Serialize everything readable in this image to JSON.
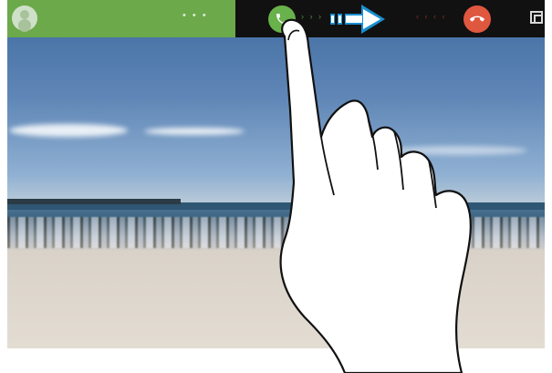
{
  "incoming_call": {
    "caller_name": "",
    "overlay_label": ""
  },
  "icons": {
    "caller_avatar": "person-avatar-icon",
    "answer": "phone-answer-icon",
    "reject": "phone-reject-icon",
    "swipe": "swipe-right-arrow-icon",
    "expand": "expand-window-icon",
    "gesture": "finger-swipe-hand-icon"
  },
  "colors": {
    "caller_panel": "#6ca94b",
    "answer": "#69b14a",
    "reject": "#e0573f",
    "status_bar": "#111111",
    "swipe_arrow": "#1a8fd0"
  }
}
